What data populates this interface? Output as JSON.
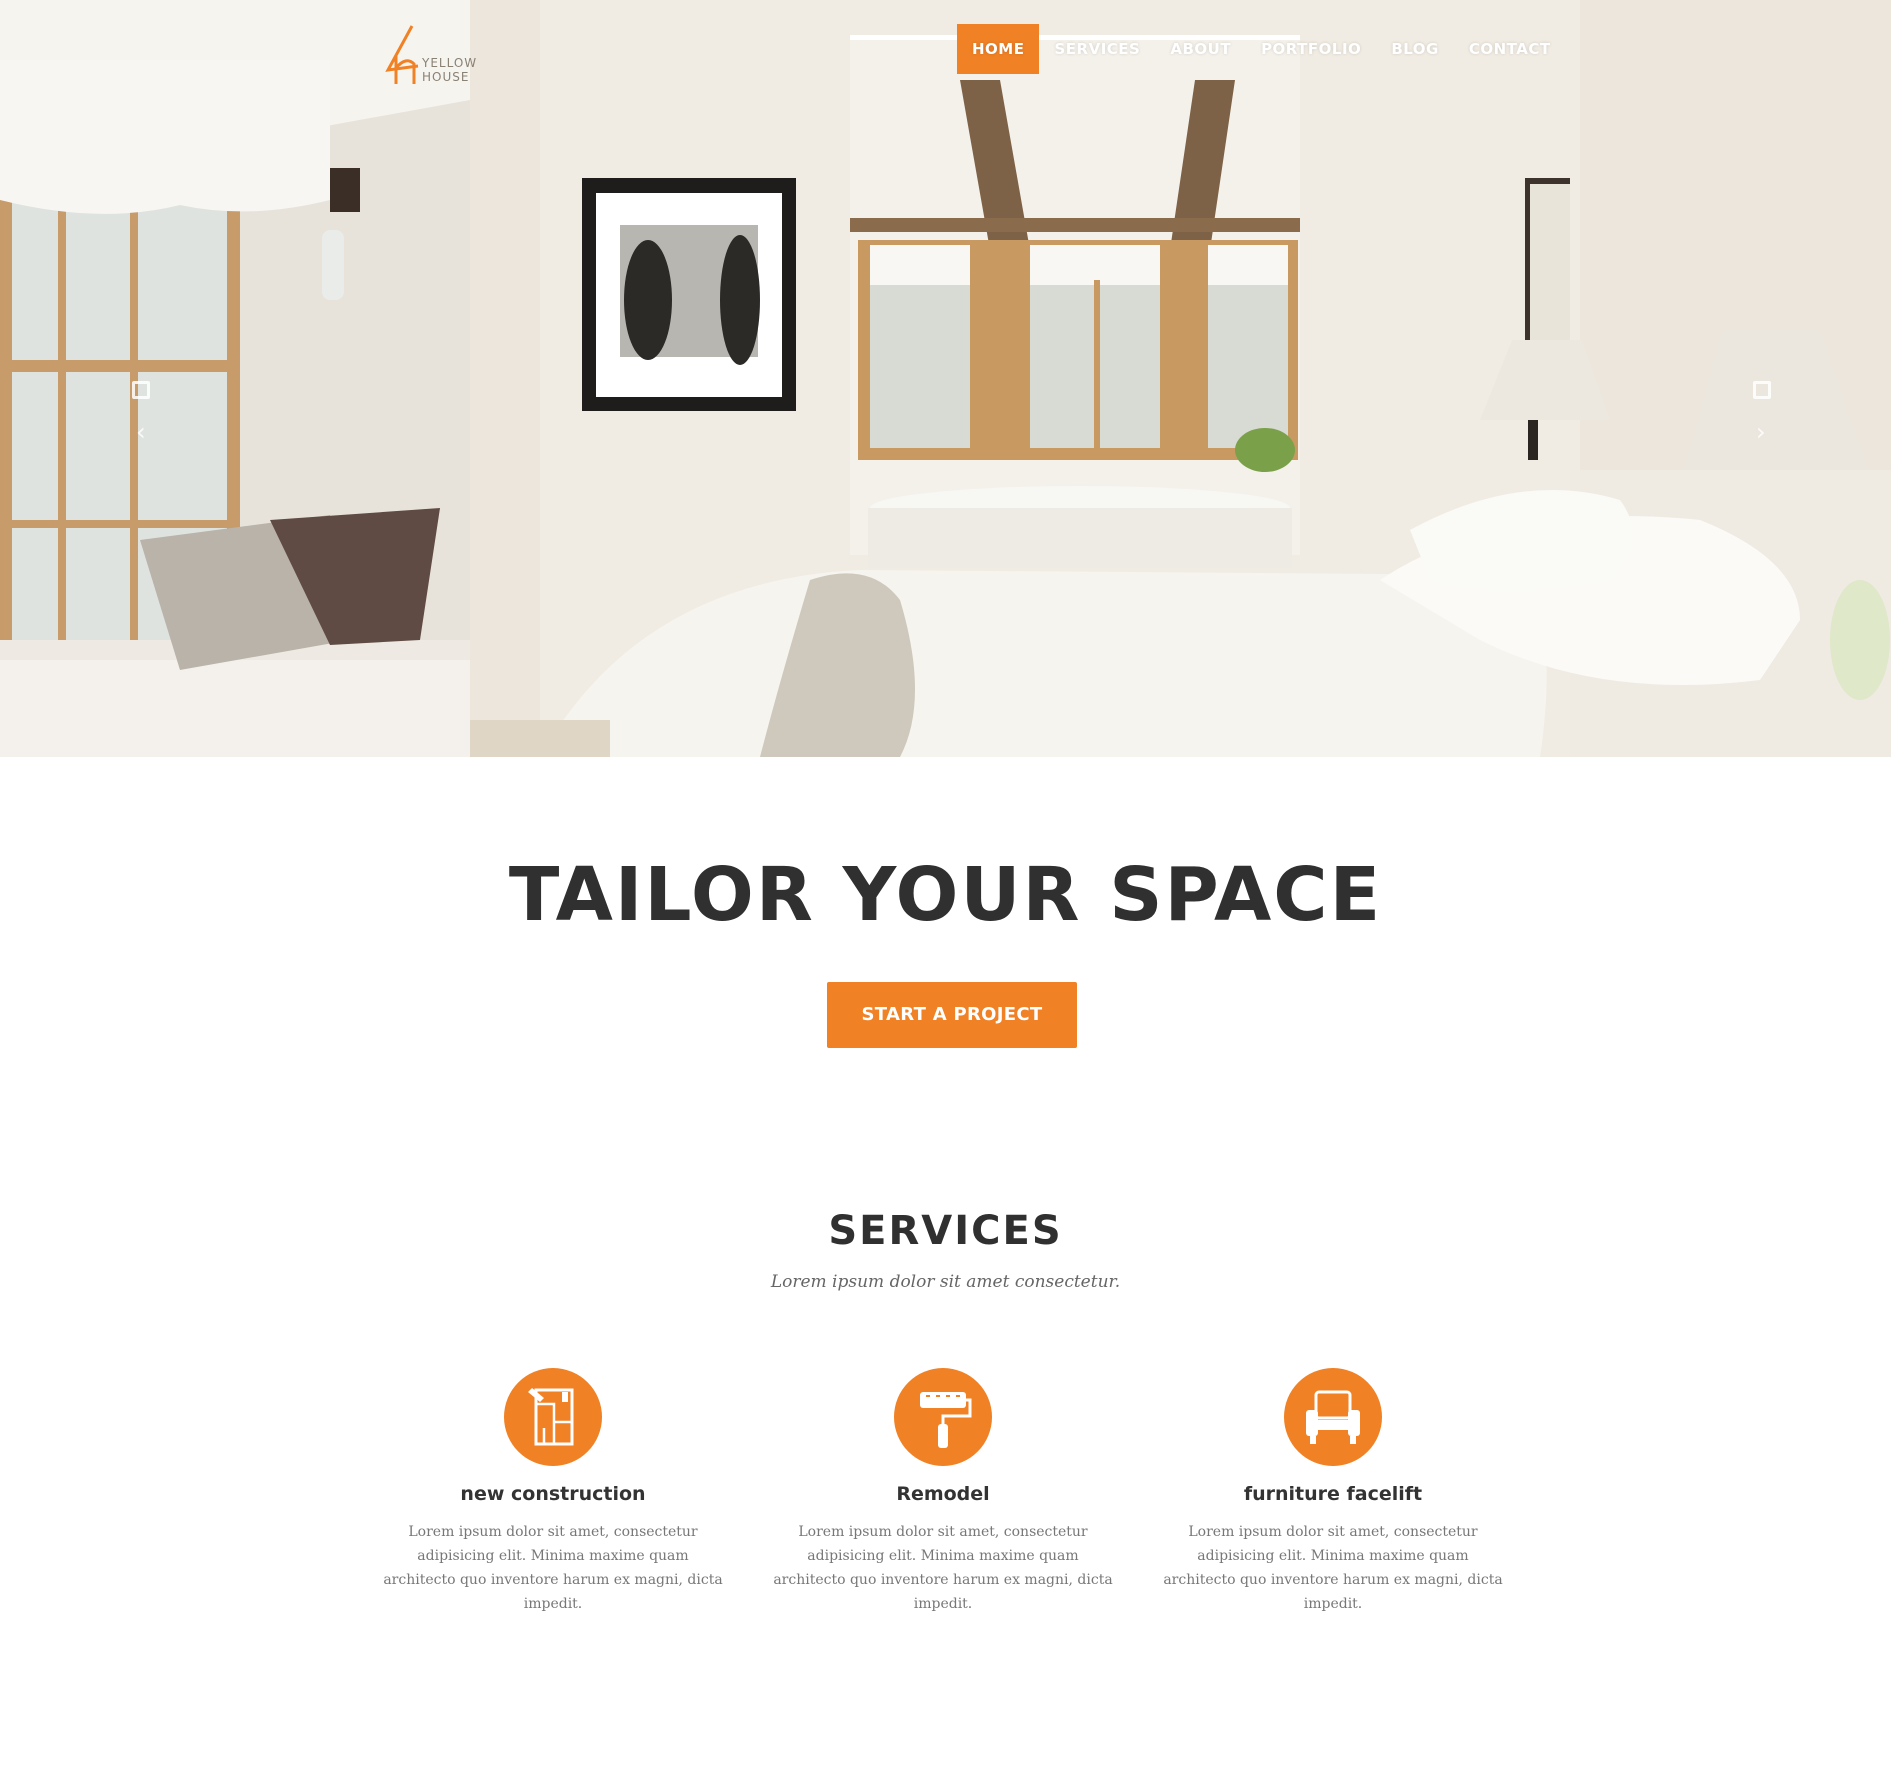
{
  "brand": {
    "line1": "YELLOW",
    "line2": "HOUSE",
    "accent": "#f08125"
  },
  "nav": {
    "items": [
      {
        "label": "HOME",
        "active": true
      },
      {
        "label": "SERVICES",
        "active": false
      },
      {
        "label": "ABOUT",
        "active": false
      },
      {
        "label": "PORTFOLIO",
        "active": false
      },
      {
        "label": "BLOG",
        "active": false
      },
      {
        "label": "CONTACT",
        "active": false
      }
    ]
  },
  "hero": {
    "prev_icon": "chevron-left-icon",
    "next_icon": "chevron-right-icon",
    "prev_glyph": "‹",
    "next_glyph": "›"
  },
  "headline": "TAILOR YOUR SPACE",
  "cta_label": "START A PROJECT",
  "services": {
    "title": "SERVICES",
    "subtitle": "Lorem ipsum dolor sit amet consectetur.",
    "items": [
      {
        "icon": "blueprint-icon",
        "name": "new construction",
        "desc": "Lorem ipsum dolor sit amet, consectetur adipisicing elit. Minima maxime quam architecto quo inventore harum ex magni, dicta impedit."
      },
      {
        "icon": "paint-roller-icon",
        "name": "Remodel",
        "desc": "Lorem ipsum dolor sit amet, consectetur adipisicing elit. Minima maxime quam architecto quo inventore harum ex magni, dicta impedit."
      },
      {
        "icon": "armchair-icon",
        "name": "furniture facelift",
        "desc": "Lorem ipsum dolor sit amet, consectetur adipisicing elit. Minima maxime quam architecto quo inventore harum ex magni, dicta impedit."
      }
    ]
  }
}
